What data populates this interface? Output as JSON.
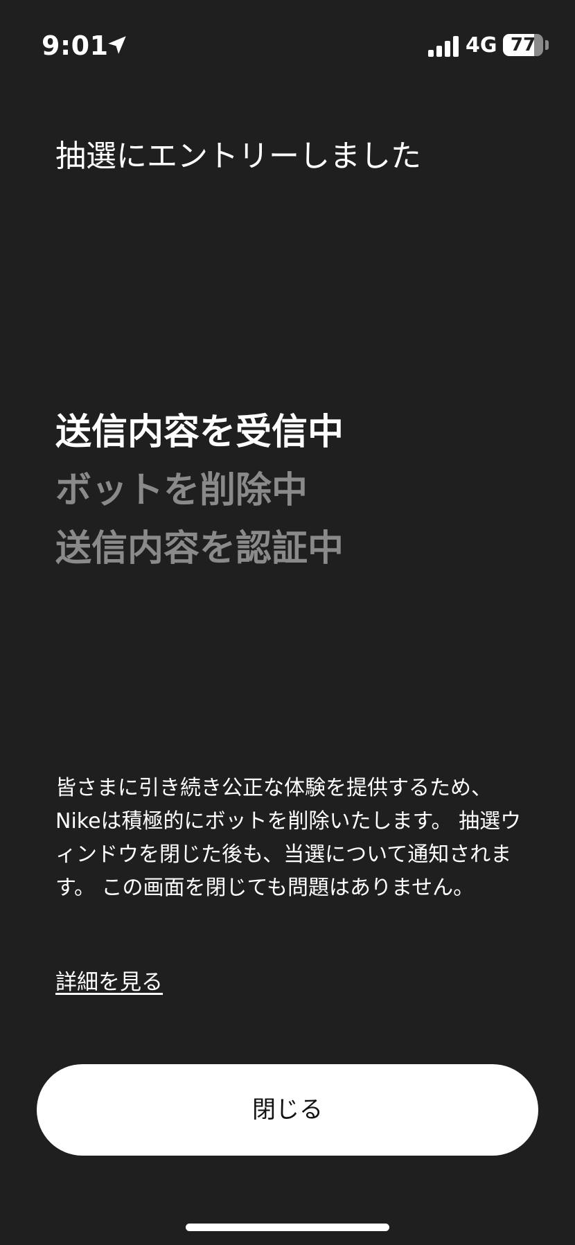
{
  "status_bar": {
    "time": "9:01",
    "location_icon": "location-arrow-icon",
    "signal_icon": "cellular-signal-icon",
    "network": "4G",
    "battery_level": "77",
    "battery_fraction": 0.77
  },
  "entry": {
    "title": "抽選にエントリーしました"
  },
  "progress": {
    "steps": [
      {
        "label": "送信内容を受信中",
        "state": "active"
      },
      {
        "label": "ボットを削除中",
        "state": "pending"
      },
      {
        "label": "送信内容を認証中",
        "state": "pending"
      }
    ]
  },
  "info": {
    "text": "皆さまに引き続き公正な体験を提供するため、Nikeは積極的にボットを削除いたします。 抽選ウィンドウを閉じた後も、当選について通知されます。 この画面を閉じても問題はありません。"
  },
  "details_link": "詳細を見る",
  "close_button": "閉じる",
  "colors": {
    "background": "#1f1f1f",
    "text_primary": "#ffffff",
    "text_pending": "#8a8a8a",
    "button_background": "#ffffff",
    "button_text": "#111111"
  }
}
